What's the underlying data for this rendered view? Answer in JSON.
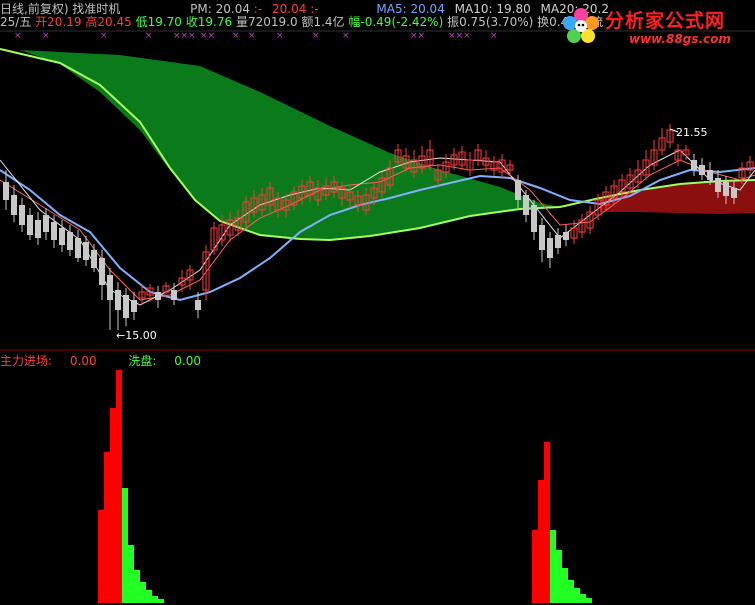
{
  "header": {
    "title": "日线,前复权) 找准时机",
    "pm_label": "PM:",
    "pm_value": "20.04",
    "pm_sep1": ":-",
    "pm_value2": "20.04",
    "pm_sep2": ":-",
    "ma5_label": "MA5:",
    "ma5_value": "20.04",
    "ma10_label": "MA10:",
    "ma10_value": "19.80",
    "ma20_label": "MA20:",
    "ma20_value": "20.2"
  },
  "quote": {
    "date": "25/五",
    "open_label": "开",
    "open_value": "20.19",
    "high_label": "高",
    "high_value": "20.45",
    "low_label": "低",
    "low_value": "19.70",
    "close_label": "收",
    "close_value": "19.76",
    "volume_label": "量",
    "volume_value": "72019.0",
    "amount_label": "额",
    "amount_value": "1.4亿",
    "change_label": "幅",
    "change_value": "-0.49(-2.42%)",
    "amplitude_label": "振",
    "amplitude_value": "0.75(3.70%)",
    "turnover_label": "换",
    "turnover_value": "0.46%",
    "float_label": "流"
  },
  "watermark": {
    "brand": "分析家公式网",
    "url": "www.88gs.com"
  },
  "annotations": {
    "low_price": "←15.00",
    "high_price": "21.55"
  },
  "indicator": {
    "main_force_label": "主力进场:",
    "main_force_value": "0.00",
    "wash_label": "洗盘:",
    "wash_value": "0.00"
  },
  "colors": {
    "up": "#ff3b3b",
    "down": "#54ffff",
    "ma_white": "#e8e8e8",
    "ma_yellow": "#e0e040",
    "ma_red": "#ff5050",
    "ma_blue": "#80b0ff",
    "ma_green": "#a0ff60",
    "cloud_green": "#0b7a1a",
    "cloud_red": "#8a1010",
    "bar_red": "#ff0000",
    "bar_green": "#22ff22",
    "divider": "#a00000"
  },
  "icons": {
    "logo": "flower-logo-icon"
  }
}
